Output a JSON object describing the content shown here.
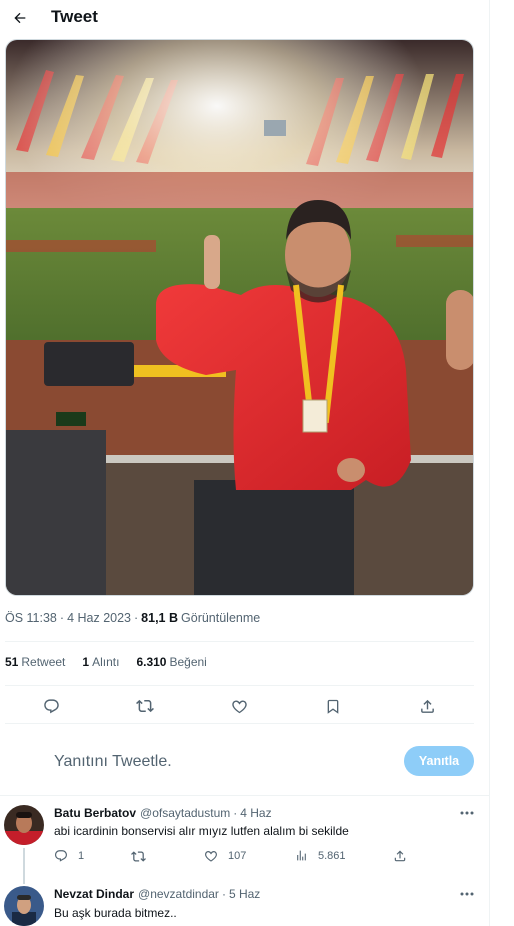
{
  "header": {
    "title": "Tweet",
    "back_icon": "arrow-left-icon"
  },
  "media": {
    "alt": "photo"
  },
  "meta": {
    "time": "ÖS 11:38",
    "date": "4 Haz 2023",
    "views_count": "81,1 B",
    "views_label": "Görüntülenme"
  },
  "stats": [
    {
      "count": "51",
      "label": "Retweet"
    },
    {
      "count": "1",
      "label": "Alıntı"
    },
    {
      "count": "6.310",
      "label": "Beğeni"
    }
  ],
  "actions": [
    "reply-icon",
    "retweet-icon",
    "like-icon",
    "bookmark-icon",
    "share-icon"
  ],
  "reply_box": {
    "placeholder": "Yanıtını Tweetle.",
    "button_label": "Yanıtla"
  },
  "replies": [
    {
      "name": "Batu Berbatov",
      "handle": "@ofsaytadustum",
      "time": "4 Haz",
      "text": "abi icardinin bonservisi alır mıyız lutfen alalım bi sekilde",
      "reply_count": "1",
      "retweet_count": "",
      "like_count": "107",
      "views_count": "5.861"
    },
    {
      "name": "Nevzat Dindar",
      "handle": "@nevzatdindar",
      "time": "5 Haz",
      "text": "Bu aşk burada bitmez.."
    }
  ],
  "colors": {
    "accent": "#1d9bf0",
    "reply_button_disabled": "#8ecdf8",
    "secondary_text": "#536471",
    "border": "#eff3f4"
  }
}
